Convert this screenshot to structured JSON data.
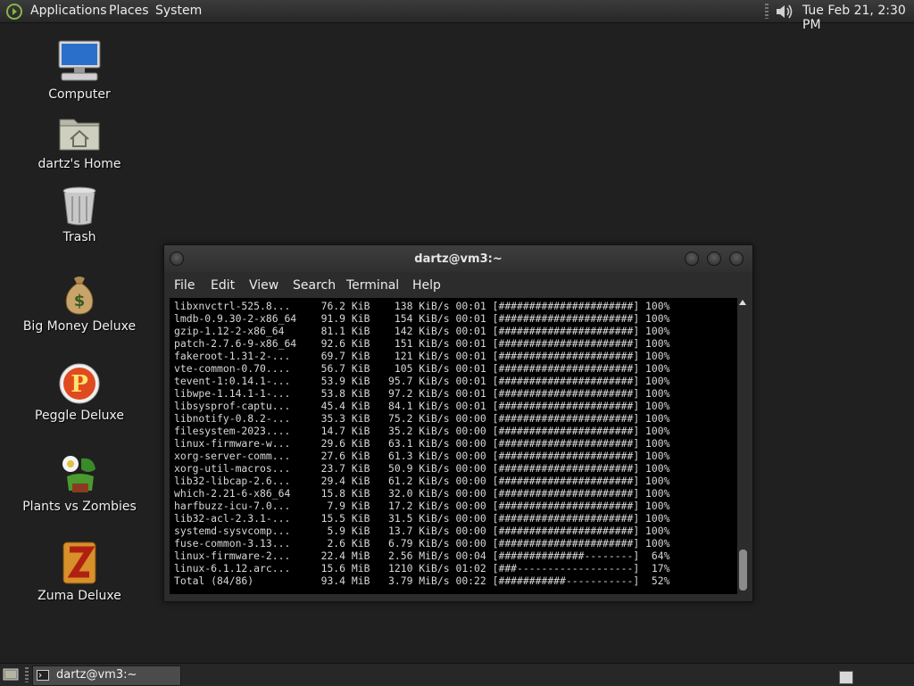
{
  "top_panel": {
    "menus": [
      "Applications",
      "Places",
      "System"
    ],
    "clock": "Tue Feb 21,  2:30 PM"
  },
  "desktop": {
    "icons": [
      {
        "label": "Computer"
      },
      {
        "label": "dartz's Home"
      },
      {
        "label": "Trash"
      },
      {
        "label": "Big Money Deluxe"
      },
      {
        "label": "Peggle Deluxe"
      },
      {
        "label": "Plants vs Zombies"
      },
      {
        "label": "Zuma Deluxe"
      }
    ]
  },
  "terminal": {
    "title": "dartz@vm3:~",
    "menu": [
      "File",
      "Edit",
      "View",
      "Search",
      "Terminal",
      "Help"
    ],
    "lines": [
      "libxnvctrl-525.8...     76.2 KiB    138 KiB/s 00:01 [######################] 100%",
      "lmdb-0.9.30-2-x86_64    91.9 KiB    154 KiB/s 00:01 [######################] 100%",
      "gzip-1.12-2-x86_64      81.1 KiB    142 KiB/s 00:01 [######################] 100%",
      "patch-2.7.6-9-x86_64    92.6 KiB    151 KiB/s 00:01 [######################] 100%",
      "fakeroot-1.31-2-...     69.7 KiB    121 KiB/s 00:01 [######################] 100%",
      "vte-common-0.70....     56.7 KiB    105 KiB/s 00:01 [######################] 100%",
      "tevent-1:0.14.1-...     53.9 KiB   95.7 KiB/s 00:01 [######################] 100%",
      "libwpe-1.14.1-1-...     53.8 KiB   97.2 KiB/s 00:01 [######################] 100%",
      "libsysprof-captu...     45.4 KiB   84.1 KiB/s 00:01 [######################] 100%",
      "libnotify-0.8.2-...     35.3 KiB   75.2 KiB/s 00:00 [######################] 100%",
      "filesystem-2023....     14.7 KiB   35.2 KiB/s 00:00 [######################] 100%",
      "linux-firmware-w...     29.6 KiB   63.1 KiB/s 00:00 [######################] 100%",
      "xorg-server-comm...     27.6 KiB   61.3 KiB/s 00:00 [######################] 100%",
      "xorg-util-macros...     23.7 KiB   50.9 KiB/s 00:00 [######################] 100%",
      "lib32-libcap-2.6...     29.4 KiB   61.2 KiB/s 00:00 [######################] 100%",
      "which-2.21-6-x86_64     15.8 KiB   32.0 KiB/s 00:00 [######################] 100%",
      "harfbuzz-icu-7.0...      7.9 KiB   17.2 KiB/s 00:00 [######################] 100%",
      "lib32-acl-2.3.1-...     15.5 KiB   31.5 KiB/s 00:00 [######################] 100%",
      "systemd-sysvcomp...      5.9 KiB   13.7 KiB/s 00:00 [######################] 100%",
      "fuse-common-3.13...      2.6 KiB   6.79 KiB/s 00:00 [######################] 100%",
      "linux-firmware-2...     22.4 MiB   2.56 MiB/s 00:04 [##############--------]  64%",
      "linux-6.1.12.arc...     15.6 MiB   1210 KiB/s 01:02 [###-------------------]  17%",
      "Total (84/86)           93.4 MiB   3.79 MiB/s 00:22 [###########-----------]  52%"
    ]
  },
  "bottom_panel": {
    "task_label": "dartz@vm3:~"
  }
}
